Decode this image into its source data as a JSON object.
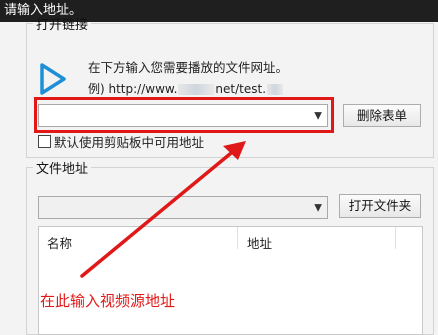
{
  "window": {
    "title": "请输入地址。"
  },
  "open_link": {
    "legend": "打开链接",
    "hint": "在下方输入您需要播放的文件网址。",
    "example_prefix": "例) http://www.",
    "example_middle": "net/test.",
    "url_input_value": "",
    "delete_button": "删除表单",
    "checkbox_label": "默认使用剪贴板中可用地址",
    "checkbox_checked": false
  },
  "file_address": {
    "legend": "文件地址",
    "path_value": "",
    "open_folder_button": "打开文件夹",
    "columns": [
      "名称",
      "地址"
    ]
  },
  "annotation": {
    "text": "在此输入视频源地址",
    "color": "#e01818"
  },
  "colors": {
    "title_bar": "#1f1f1f",
    "play_icon": "#1e8fd6",
    "highlight": "#e01818"
  }
}
